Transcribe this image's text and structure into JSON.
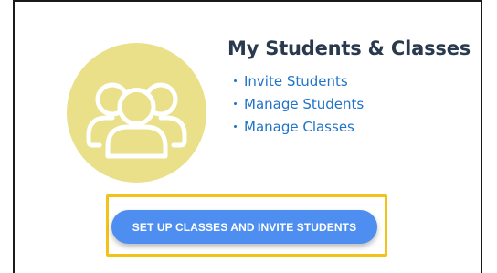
{
  "card": {
    "title": "My Students & Classes",
    "icon": "students-group-icon",
    "links": [
      {
        "label": "Invite Students"
      },
      {
        "label": "Manage Students"
      },
      {
        "label": "Manage Classes"
      }
    ],
    "cta_label": "SET UP CLASSES AND INVITE STUDENTS"
  },
  "colors": {
    "avatar_bg": "#e9e089",
    "title": "#2a3a4e",
    "link": "#1f73c9",
    "cta_bg": "#4d8ef0",
    "highlight_border": "#f2c21a"
  }
}
